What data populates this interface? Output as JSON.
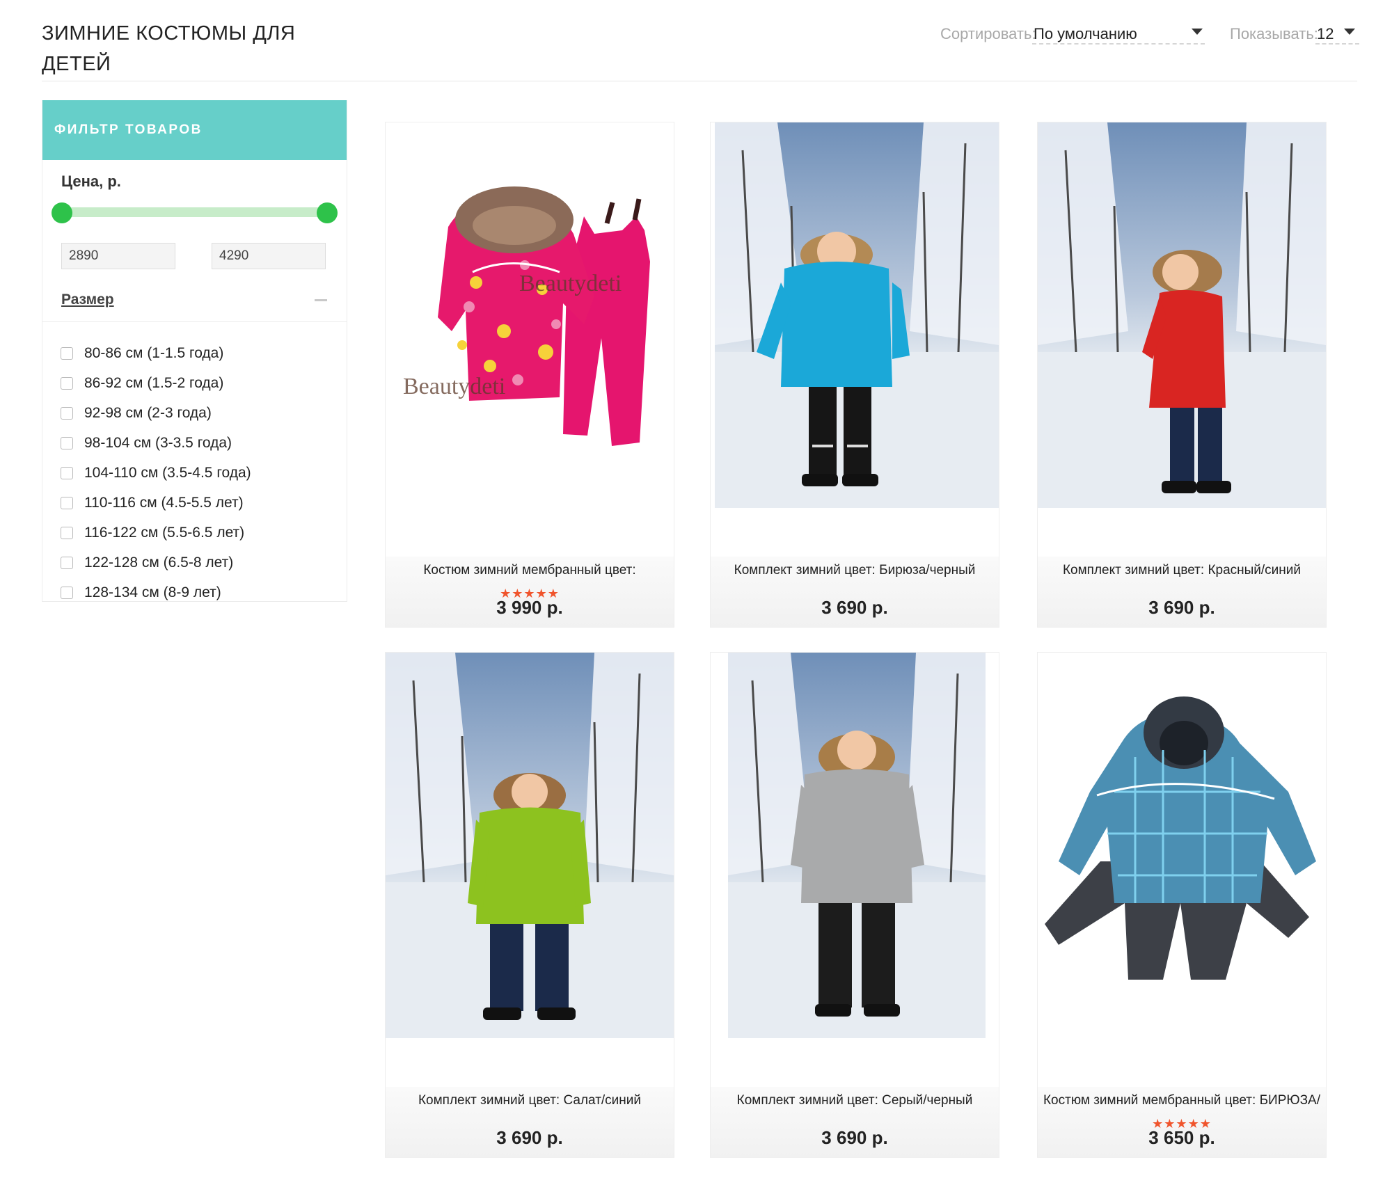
{
  "page": {
    "title": "ЗИМНИЕ КОСТЮМЫ ДЛЯ ДЕТЕЙ"
  },
  "toolbar": {
    "sort_label": "Сортировать:",
    "sort_value": "По умолчанию",
    "show_label": "Показывать:",
    "show_value": "12"
  },
  "filter": {
    "header": "ФИЛЬТР ТОВАРОВ",
    "price_label": "Цена, р.",
    "price_min": "2890",
    "price_max": "4290",
    "size_title": "Размер",
    "sizes": [
      "80-86 см (1-1.5 года)",
      "86-92 см (1.5-2 года)",
      "92-98 см (2-3 года)",
      "98-104 см (3-3.5 года)",
      "104-110 см (3.5-4.5 года)",
      "110-116 см (4.5-5.5 лет)",
      "116-122 см (5.5-6.5 лет)",
      "122-128 см (6.5-8 лет)",
      "128-134 см (8-9 лет)"
    ]
  },
  "products": [
    {
      "name": "Костюм зимний мембранный цвет:",
      "price": "3 990 р.",
      "rating": 5,
      "stars": "★★★★★",
      "watermark": "Beautydeti"
    },
    {
      "name": "Комплект зимний цвет: Бирюза/черный",
      "price": "3 690 р."
    },
    {
      "name": "Комплект зимний цвет: Красный/синий",
      "price": "3 690 р."
    },
    {
      "name": "Комплект зимний цвет: Салат/синий",
      "price": "3 690 р."
    },
    {
      "name": "Комплект зимний цвет: Серый/черный",
      "price": "3 690 р."
    },
    {
      "name": "Костюм зимний мембранный цвет: БИРЮЗА/",
      "price": "3 650 р.",
      "rating": 5,
      "stars": "★★★★★"
    }
  ],
  "colors": {
    "filter_header": "#66cfc9",
    "slider_track": "#c7ecc9",
    "slider_handle": "#2ec24a",
    "star": "#f0542c"
  }
}
